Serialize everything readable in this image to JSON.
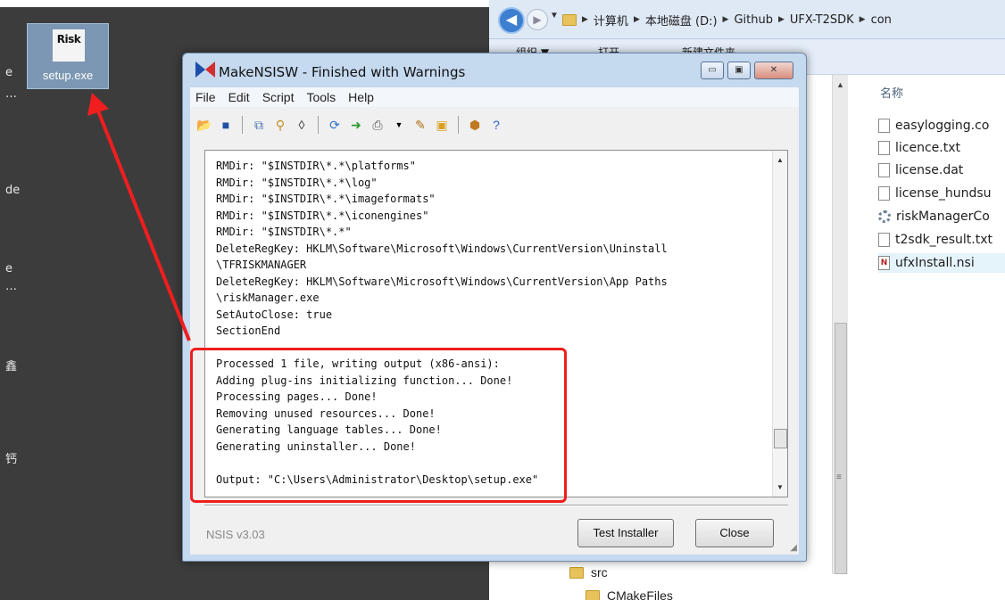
{
  "desktop": {
    "edge_texts": [
      "e",
      "…",
      "de",
      "e",
      "…",
      "鑫",
      "钙"
    ],
    "icon": {
      "thumb_text": "Risk",
      "label": "setup.exe"
    }
  },
  "explorer": {
    "breadcrumbs": [
      "计算机",
      "本地磁盘 (D:)",
      "Github",
      "UFX-T2SDK",
      "con"
    ],
    "toolbar": [
      "组织 ▼",
      "打开",
      "新建文件夹"
    ],
    "column_header": "名称",
    "files": [
      {
        "name": "easylogging.co",
        "icon": "document-icon"
      },
      {
        "name": "licence.txt",
        "icon": "text-file-icon"
      },
      {
        "name": "license.dat",
        "icon": "document-icon"
      },
      {
        "name": "license_hundsu",
        "icon": "document-icon"
      },
      {
        "name": "riskManagerCo",
        "icon": "gear-file-icon"
      },
      {
        "name": "t2sdk_result.txt",
        "icon": "text-file-icon"
      },
      {
        "name": "ufxInstall.nsi",
        "icon": "nsi-file-icon",
        "selected": true
      }
    ],
    "bottom_items": [
      "src",
      "CMakeFiles"
    ]
  },
  "dialog": {
    "title": "MakeNSISW - Finished with Warnings",
    "menu": [
      "File",
      "Edit",
      "Script",
      "Tools",
      "Help"
    ],
    "caption_buttons": [
      "▭",
      "▣",
      "✕"
    ],
    "log_lines": [
      "RMDir: \"$INSTDIR\\*.*\\platforms\"",
      "RMDir: \"$INSTDIR\\*.*\\log\"",
      "RMDir: \"$INSTDIR\\*.*\\imageformats\"",
      "RMDir: \"$INSTDIR\\*.*\\iconengines\"",
      "RMDir: \"$INSTDIR\\*.*\"",
      "DeleteRegKey: HKLM\\Software\\Microsoft\\Windows\\CurrentVersion\\Uninstall",
      "\\TFRISKMANAGER",
      "DeleteRegKey: HKLM\\Software\\Microsoft\\Windows\\CurrentVersion\\App Paths",
      "\\riskManager.exe",
      "SetAutoClose: true",
      "SectionEnd",
      "",
      "Processed 1 file, writing output (x86-ansi):",
      "Adding plug-ins initializing function... Done!",
      "Processing pages... Done!",
      "Removing unused resources... Done!",
      "Generating language tables... Done!",
      "Generating uninstaller... Done!",
      "",
      "Output: \"C:\\Users\\Administrator\\Desktop\\setup.exe\""
    ],
    "version": "NSIS v3.03",
    "buttons": {
      "test": "Test Installer",
      "close": "Close"
    }
  },
  "annotation": {
    "color": "#f01e1e"
  }
}
